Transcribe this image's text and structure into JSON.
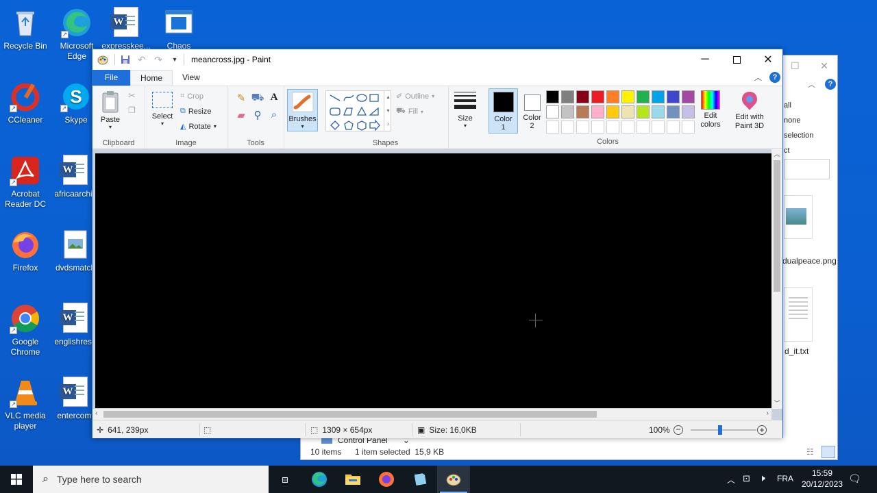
{
  "desktop": {
    "icons": [
      {
        "label": "Recycle Bin",
        "icon": "recycle-bin-icon"
      },
      {
        "label": "Microsoft Edge",
        "icon": "edge-icon"
      },
      {
        "label": "expresskee...",
        "icon": "word-doc-icon"
      },
      {
        "label": "Chaos",
        "icon": "window-icon"
      },
      {
        "label": "CCleaner",
        "icon": "ccleaner-icon"
      },
      {
        "label": "Skype",
        "icon": "skype-icon"
      },
      {
        "label": "Acrobat Reader DC",
        "icon": "acrobat-icon"
      },
      {
        "label": "africaarchiv",
        "icon": "word-doc-icon"
      },
      {
        "label": "Firefox",
        "icon": "firefox-icon"
      },
      {
        "label": "dvdsmatch",
        "icon": "image-file-icon"
      },
      {
        "label": "Google Chrome",
        "icon": "chrome-icon"
      },
      {
        "label": "englishrese",
        "icon": "word-doc-icon"
      },
      {
        "label": "VLC media player",
        "icon": "vlc-icon"
      },
      {
        "label": "entercom.",
        "icon": "word-doc-icon"
      }
    ]
  },
  "explorer": {
    "ribbon_items": [
      "all",
      "none",
      "selection",
      "ct"
    ],
    "files": [
      {
        "name": "dualpeace.png"
      },
      {
        "name": "d_it.txt"
      }
    ],
    "address_item": "Control Panel",
    "status_items": "10 items",
    "status_selected": "1 item selected  15,9 KB"
  },
  "paint": {
    "title": "meancross.jpg - Paint",
    "tabs": {
      "file": "File",
      "home": "Home",
      "view": "View"
    },
    "clipboard": {
      "paste": "Paste",
      "group": "Clipboard"
    },
    "image": {
      "select": "Select",
      "crop": "Crop",
      "resize": "Resize",
      "rotate": "Rotate",
      "group": "Image"
    },
    "tools": {
      "group": "Tools",
      "text_glyph": "A"
    },
    "brushes": {
      "label": "Brushes"
    },
    "shapes": {
      "outline": "Outline",
      "fill": "Fill",
      "group": "Shapes"
    },
    "size": {
      "label": "Size"
    },
    "color1": {
      "label": "Color",
      "num": "1",
      "value": "#000000"
    },
    "color2": {
      "label": "Color",
      "num": "2",
      "value": "#ffffff"
    },
    "colors": {
      "group": "Colors",
      "edit": "Edit colors",
      "paint3d": "Edit with Paint 3D",
      "palette_row1": [
        "#000000",
        "#7f7f7f",
        "#880015",
        "#ed1c24",
        "#ff7f27",
        "#fff200",
        "#22b14c",
        "#00a2e8",
        "#3f48cc",
        "#a349a4"
      ],
      "palette_row2": [
        "#ffffff",
        "#c3c3c3",
        "#b97a57",
        "#ffaec9",
        "#ffc90e",
        "#efe4b0",
        "#b5e61d",
        "#99d9ea",
        "#7092be",
        "#c8bfe7"
      ],
      "palette_row3": [
        "#ffffff",
        "#ffffff",
        "#ffffff",
        "#ffffff",
        "#ffffff",
        "#ffffff",
        "#ffffff",
        "#ffffff",
        "#ffffff",
        "#ffffff"
      ]
    },
    "status": {
      "cursor": "641, 239px",
      "dimensions": "1309 × 654px",
      "size": "Size: 16,0KB",
      "zoom": "100%"
    }
  },
  "taskbar": {
    "search_placeholder": "Type here to search",
    "language": "FRA",
    "time": "15:59",
    "date": "20/12/2023"
  }
}
